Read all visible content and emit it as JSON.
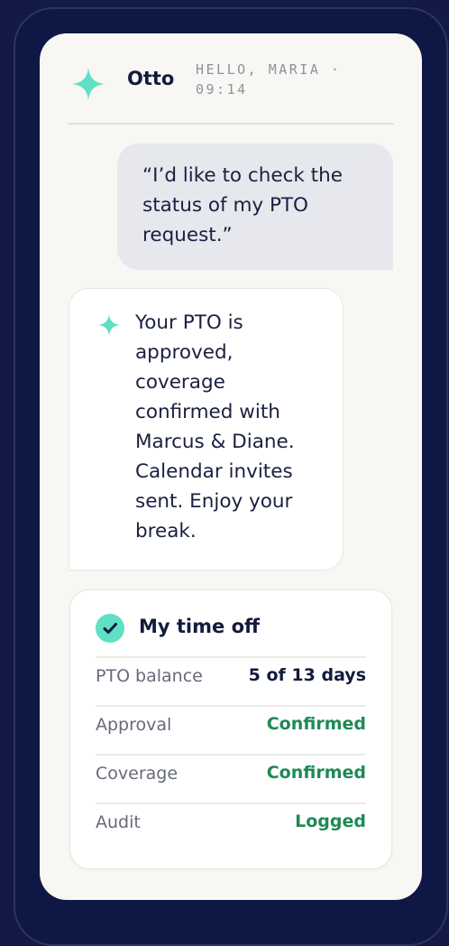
{
  "app": {
    "assistant_name": "Otto",
    "greeting": "HELLO, MARIA · 09:14"
  },
  "conversation": {
    "user_message": "“I’d like to check the status of my PTO request.”",
    "assistant_message": "Your PTO is approved, coverage confirmed with Marcus & Diane. Calendar invites sent. Enjoy your break."
  },
  "card": {
    "title": "My time off",
    "rows": [
      {
        "label": "PTO balance",
        "value": "5 of 13 days",
        "status": "neutral"
      },
      {
        "label": "Approval",
        "value": "Confirmed",
        "status": "success"
      },
      {
        "label": "Coverage",
        "value": "Confirmed",
        "status": "success"
      },
      {
        "label": "Audit",
        "value": "Logged",
        "status": "success"
      }
    ]
  },
  "colors": {
    "background": "#121a45",
    "screen": "#f8f7f3",
    "accent": "#5edfc6",
    "success": "#1e8a54",
    "text": "#141a3c"
  },
  "icons": {
    "assistant": "sparkle-icon",
    "message": "sparkle-icon",
    "card": "check-circle-icon"
  }
}
